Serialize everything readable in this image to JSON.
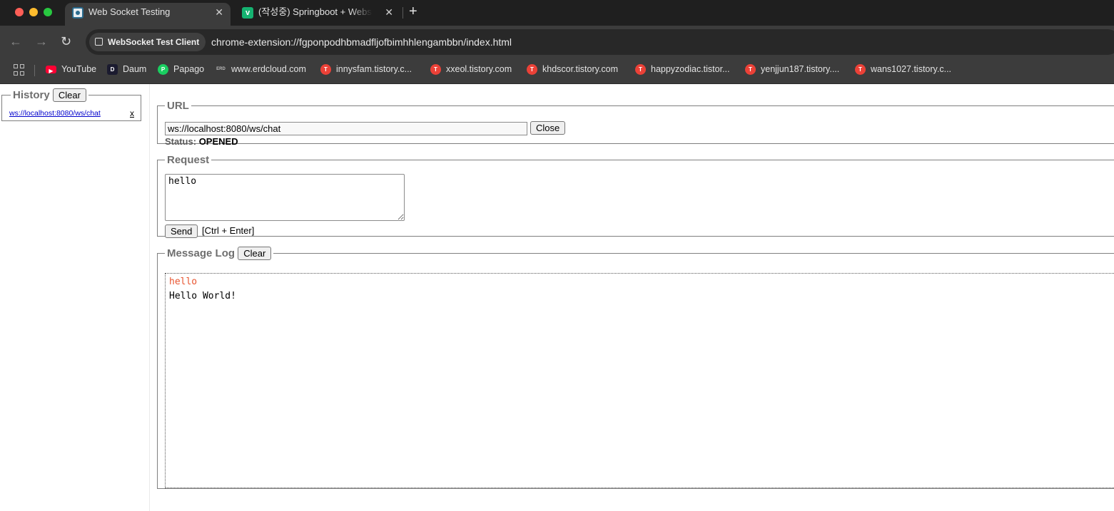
{
  "browser": {
    "tabs": [
      {
        "title": "Web Socket Testing",
        "active": true,
        "favicon": "websocket-icon"
      },
      {
        "title": "(작성중) Springboot + Websocket",
        "active": false,
        "favicon": "velog-icon"
      }
    ],
    "new_tab_label": "+",
    "address": {
      "site_chip": "WebSocket Test Client",
      "url": "chrome-extension://fgponpodhbmadfljofbimhhlengambbn/index.html"
    },
    "bookmarks": [
      {
        "label": "YouTube",
        "icon": "youtube-icon"
      },
      {
        "label": "Daum",
        "icon": "daum-icon"
      },
      {
        "label": "Papago",
        "icon": "papago-icon"
      },
      {
        "label": "www.erdcloud.com",
        "icon": "erd-icon"
      },
      {
        "label": "innysfam.tistory.c...",
        "icon": "tistory-icon"
      },
      {
        "label": "xxeol.tistory.com",
        "icon": "tistory-icon"
      },
      {
        "label": "khdscor.tistory.com",
        "icon": "tistory-icon"
      },
      {
        "label": "happyzodiac.tistor...",
        "icon": "tistory-icon"
      },
      {
        "label": "yenjjun187.tistory....",
        "icon": "tistory-icon"
      },
      {
        "label": "wans1027.tistory.c...",
        "icon": "tistory-icon"
      }
    ]
  },
  "history": {
    "legend": "History",
    "clear_label": "Clear",
    "items": [
      {
        "url": "ws://localhost:8080/ws/chat",
        "remove_label": "x"
      }
    ]
  },
  "url_section": {
    "legend": "URL",
    "value": "ws://localhost:8080/ws/chat",
    "close_label": "Close",
    "status_label": "Status:",
    "status_value": "OPENED"
  },
  "request_section": {
    "legend": "Request",
    "value": "hello",
    "send_label": "Send",
    "hint": "[Ctrl + Enter]"
  },
  "log_section": {
    "legend": "Message Log",
    "clear_label": "Clear",
    "messages": [
      {
        "text": "hello",
        "direction": "sent"
      },
      {
        "text": "Hello World!",
        "direction": "received"
      }
    ]
  },
  "colors": {
    "sent_message": "#e8542f",
    "link": "#0000cc",
    "chrome_dark": "#3c3c3c"
  }
}
